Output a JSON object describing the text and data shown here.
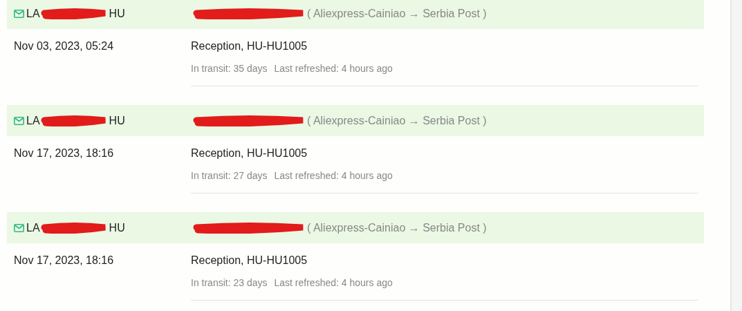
{
  "shipments": [
    {
      "tracking_start": "LA",
      "tracking_end": "HU",
      "tracking_redacted": true,
      "sender_redacted": true,
      "route": "( Aliexpress-Cainiao → Serbia Post )",
      "date": "Nov 03, 2023, 05:24",
      "location": "Reception, HU-HU1005",
      "transit": "In transit: 35 days",
      "refreshed": "Last refreshed: 4 hours ago"
    },
    {
      "tracking_start": "LA",
      "tracking_end": "HU",
      "tracking_redacted": true,
      "sender_redacted": true,
      "route": "( Aliexpress-Cainiao → Serbia Post )",
      "date": "Nov 17, 2023, 18:16",
      "location": "Reception, HU-HU1005",
      "transit": "In transit: 27 days",
      "refreshed": "Last refreshed: 4 hours ago"
    },
    {
      "tracking_start": "LA",
      "tracking_end": "HU",
      "tracking_redacted": true,
      "sender_redacted": true,
      "route": "( Aliexpress-Cainiao → Serbia Post )",
      "date": "Nov 17, 2023, 18:16",
      "location": "Reception, HU-HU1005",
      "transit": "In transit: 23 days",
      "refreshed": "Last refreshed: 4 hours ago"
    }
  ]
}
